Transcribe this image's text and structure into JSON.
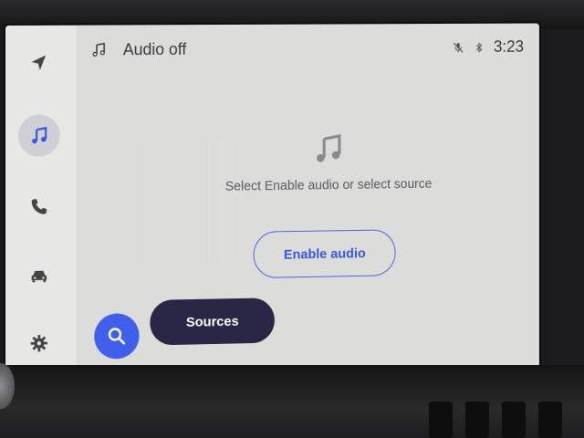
{
  "header": {
    "title": "Audio off",
    "clock": "3:23"
  },
  "main": {
    "prompt": "Select Enable audio or select source",
    "enable_label": "Enable audio",
    "sources_label": "Sources"
  },
  "rail": {
    "items": [
      "navigation-icon",
      "music-icon",
      "phone-icon",
      "car-icon",
      "settings-icon"
    ],
    "active": "music-icon"
  },
  "colors": {
    "accent": "#4060ea",
    "sources_bg": "#2a2746",
    "screen_bg": "#dcdcda"
  }
}
